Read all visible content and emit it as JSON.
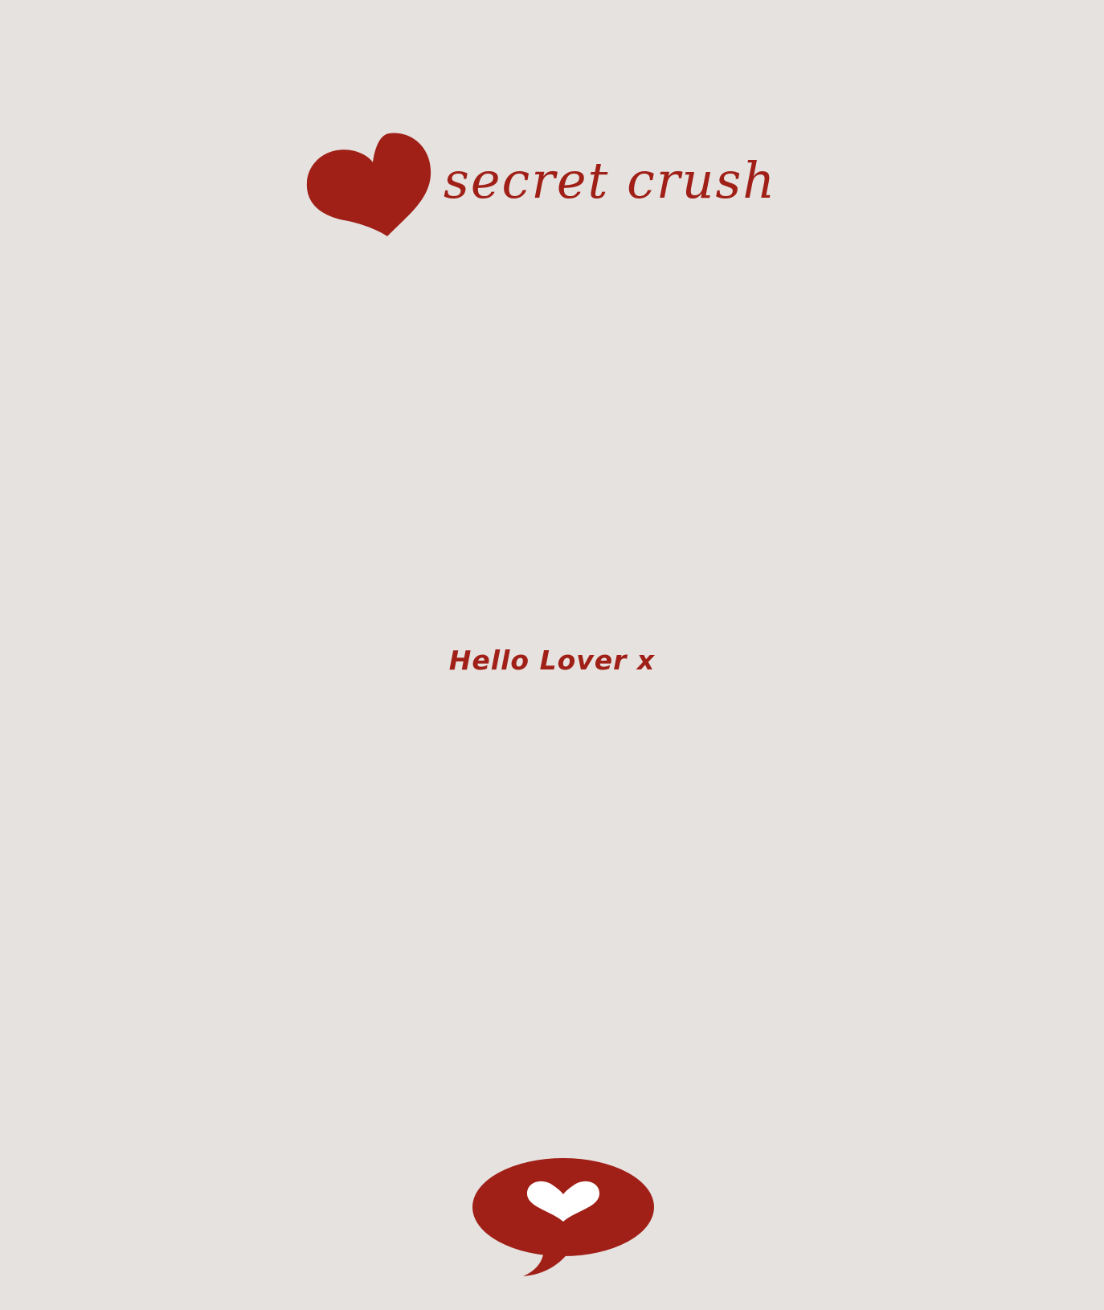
{
  "brand": {
    "name": "secret crush",
    "accent_color": "#a02018",
    "background_color": "#e6e2df",
    "logo_icon": "heart-icon"
  },
  "main": {
    "greeting": "Hello Lover x"
  },
  "chat_button": {
    "icon": "heart-speech-bubble-icon"
  }
}
